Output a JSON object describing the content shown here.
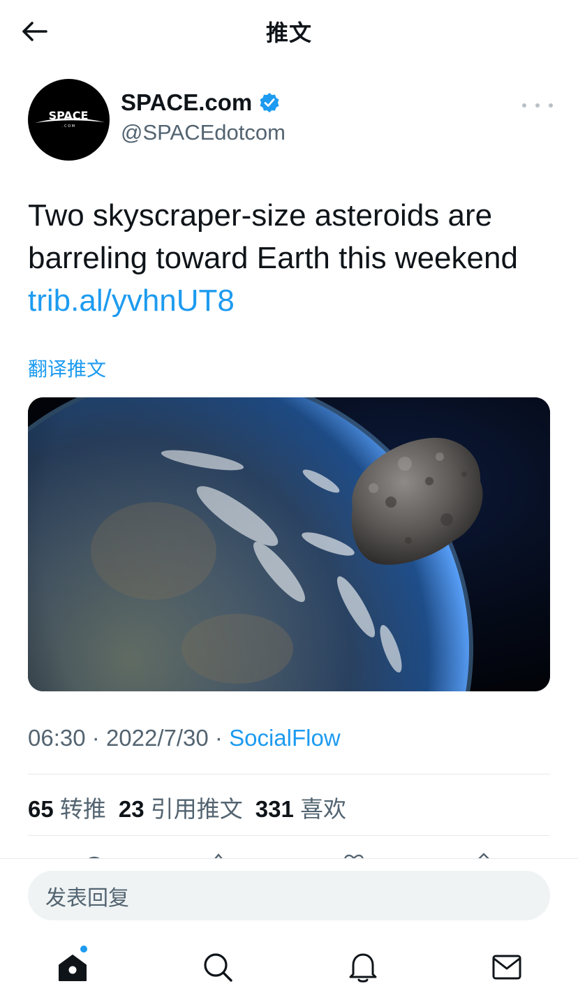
{
  "header": {
    "title": "推文",
    "back_icon": "arrow-left-icon"
  },
  "author": {
    "display_name": "SPACE.com",
    "handle": "@SPACEdotcom",
    "avatar_logo_text": "SPACE",
    "verified": true,
    "verified_color": "#1d9bf0"
  },
  "tweet": {
    "text": "Two skyscraper-size asteroids are barreling toward Earth this weekend",
    "link": "trib.al/yvhnUT8",
    "translate_label": "翻译推文",
    "media_description_icon": "photo-earth-asteroid"
  },
  "meta": {
    "time": "06:30",
    "separator": "·",
    "date": "2022/7/30",
    "source": "SocialFlow"
  },
  "stats": {
    "retweets": {
      "count": "65",
      "label": "转推"
    },
    "quotes": {
      "count": "23",
      "label": "引用推文"
    },
    "likes": {
      "count": "331",
      "label": "喜欢"
    }
  },
  "reply": {
    "placeholder": "发表回复"
  },
  "nav": {
    "items": [
      "home-icon",
      "search-icon",
      "bell-icon",
      "mail-icon"
    ],
    "home_has_notification_dot": true
  },
  "colors": {
    "accent": "#1d9bf0",
    "text": "#0f1419",
    "secondary": "#536471"
  }
}
